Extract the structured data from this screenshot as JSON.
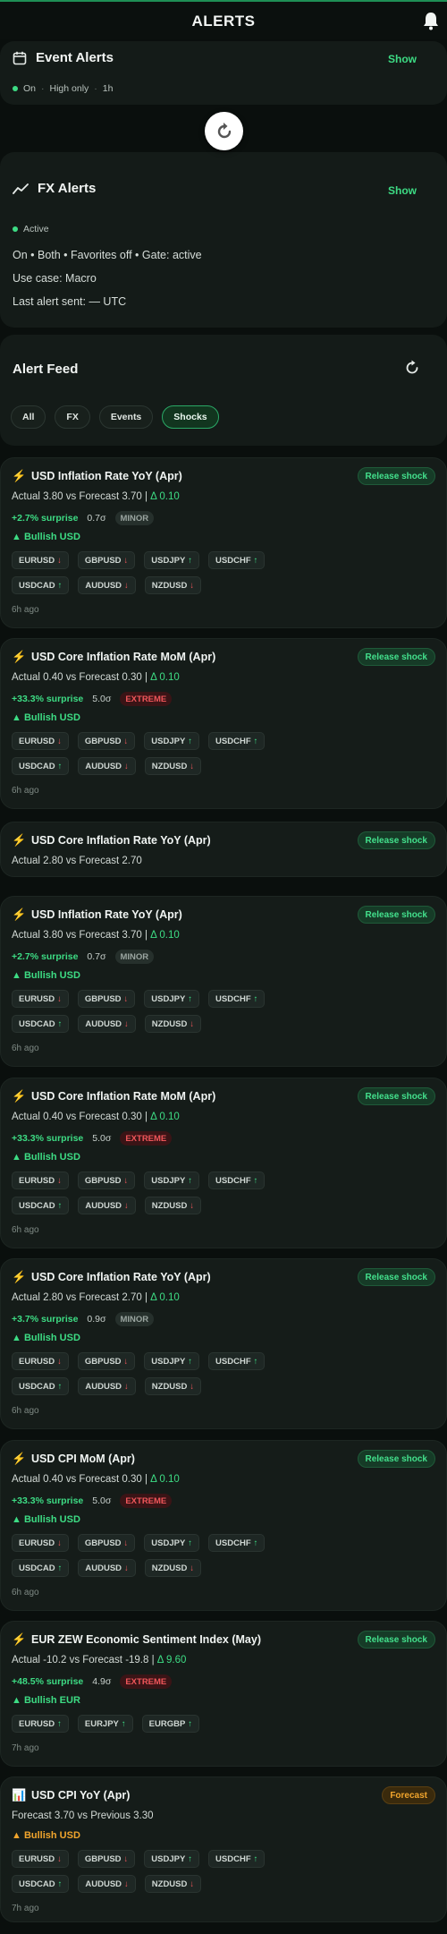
{
  "header": {
    "title": "ALERTS",
    "icon": "bell-icon"
  },
  "event_alerts": {
    "title": "Event Alerts",
    "icon": "calendar-icon",
    "show_label": "Show",
    "status": "On",
    "filter": "High only",
    "window": "1h"
  },
  "fx_alerts": {
    "title": "FX Alerts",
    "icon": "trend-line-icon",
    "show_label": "Show",
    "status": "Active",
    "line1": "On • Both • Favorites off • Gate: active",
    "line2": "Use case: Macro",
    "line3": "Last alert sent: — UTC"
  },
  "feed": {
    "title": "Alert Feed",
    "filters": [
      "All",
      "FX",
      "Events",
      "Shocks"
    ],
    "active_filter": "Shocks"
  },
  "cards": [
    {
      "icon": "⚡",
      "title": "USD Inflation Rate YoY (Apr)",
      "badge": "Release shock",
      "line1": "Actual 3.80 vs Forecast 3.70 | ",
      "delta": "Δ 0.10",
      "surprise": "+2.7% surprise",
      "sigma": "0.7σ",
      "tag": "MINOR",
      "bias": "▲ Bullish USD",
      "pairs": [
        {
          "name": "EURUSD",
          "dir": "↓"
        },
        {
          "name": "GBPUSD",
          "dir": "↓"
        },
        {
          "name": "USDJPY",
          "dir": "↑"
        },
        {
          "name": "USDCHF",
          "dir": "↑"
        },
        {
          "name": "USDCAD",
          "dir": "↑"
        },
        {
          "name": "AUDUSD",
          "dir": "↓"
        },
        {
          "name": "NZDUSD",
          "dir": "↓"
        }
      ],
      "ago": "6h ago"
    },
    {
      "icon": "⚡",
      "title": "USD Core Inflation Rate MoM (Apr)",
      "badge": "Release shock",
      "line1": "Actual 0.40 vs Forecast 0.30 | ",
      "delta": "Δ 0.10",
      "surprise": "+33.3% surprise",
      "sigma": "5.0σ",
      "tag": "EXTREME",
      "bias": "▲ Bullish USD",
      "pairs": [
        {
          "name": "EURUSD",
          "dir": "↓"
        },
        {
          "name": "GBPUSD",
          "dir": "↓"
        },
        {
          "name": "USDJPY",
          "dir": "↑"
        },
        {
          "name": "USDCHF",
          "dir": "↑"
        },
        {
          "name": "USDCAD",
          "dir": "↑"
        },
        {
          "name": "AUDUSD",
          "dir": "↓"
        },
        {
          "name": "NZDUSD",
          "dir": "↓"
        }
      ],
      "ago": "6h ago"
    },
    {
      "icon": "⚡",
      "title": "USD Core Inflation Rate YoY (Apr)",
      "badge": "Release shock",
      "line1": "Actual 2.80 vs Forecast 2.70"
    },
    {
      "icon": "⚡",
      "title": "USD Inflation Rate YoY (Apr)",
      "badge": "Release shock",
      "line1": "Actual 3.80 vs Forecast 3.70 | ",
      "delta": "Δ 0.10",
      "surprise": "+2.7% surprise",
      "sigma": "0.7σ",
      "tag": "MINOR",
      "bias": "▲ Bullish USD",
      "pairs": [
        {
          "name": "EURUSD",
          "dir": "↓"
        },
        {
          "name": "GBPUSD",
          "dir": "↓"
        },
        {
          "name": "USDJPY",
          "dir": "↑"
        },
        {
          "name": "USDCHF",
          "dir": "↑"
        },
        {
          "name": "USDCAD",
          "dir": "↑"
        },
        {
          "name": "AUDUSD",
          "dir": "↓"
        },
        {
          "name": "NZDUSD",
          "dir": "↓"
        }
      ],
      "ago": "6h ago"
    },
    {
      "icon": "⚡",
      "title": "USD Core Inflation Rate MoM (Apr)",
      "badge": "Release shock",
      "line1": "Actual 0.40 vs Forecast 0.30 | ",
      "delta": "Δ 0.10",
      "surprise": "+33.3% surprise",
      "sigma": "5.0σ",
      "tag": "EXTREME",
      "bias": "▲ Bullish USD",
      "pairs": [
        {
          "name": "EURUSD",
          "dir": "↓"
        },
        {
          "name": "GBPUSD",
          "dir": "↓"
        },
        {
          "name": "USDJPY",
          "dir": "↑"
        },
        {
          "name": "USDCHF",
          "dir": "↑"
        },
        {
          "name": "USDCAD",
          "dir": "↑"
        },
        {
          "name": "AUDUSD",
          "dir": "↓"
        },
        {
          "name": "NZDUSD",
          "dir": "↓"
        }
      ],
      "ago": "6h ago"
    },
    {
      "icon": "⚡",
      "title": "USD Core Inflation Rate YoY (Apr)",
      "badge": "Release shock",
      "line1": "Actual 2.80 vs Forecast 2.70 | ",
      "delta": "Δ 0.10",
      "surprise": "+3.7% surprise",
      "sigma": "0.9σ",
      "tag": "MINOR",
      "bias": "▲ Bullish USD",
      "pairs": [
        {
          "name": "EURUSD",
          "dir": "↓"
        },
        {
          "name": "GBPUSD",
          "dir": "↓"
        },
        {
          "name": "USDJPY",
          "dir": "↑"
        },
        {
          "name": "USDCHF",
          "dir": "↑"
        },
        {
          "name": "USDCAD",
          "dir": "↑"
        },
        {
          "name": "AUDUSD",
          "dir": "↓"
        },
        {
          "name": "NZDUSD",
          "dir": "↓"
        }
      ],
      "ago": "6h ago"
    },
    {
      "icon": "⚡",
      "title": "USD CPI MoM (Apr)",
      "badge": "Release shock",
      "line1": "Actual 0.40 vs Forecast 0.30 | ",
      "delta": "Δ 0.10",
      "surprise": "+33.3% surprise",
      "sigma": "5.0σ",
      "tag": "EXTREME",
      "bias": "▲ Bullish USD",
      "pairs": [
        {
          "name": "EURUSD",
          "dir": "↓"
        },
        {
          "name": "GBPUSD",
          "dir": "↓"
        },
        {
          "name": "USDJPY",
          "dir": "↑"
        },
        {
          "name": "USDCHF",
          "dir": "↑"
        },
        {
          "name": "USDCAD",
          "dir": "↑"
        },
        {
          "name": "AUDUSD",
          "dir": "↓"
        },
        {
          "name": "NZDUSD",
          "dir": "↓"
        }
      ],
      "ago": "6h ago"
    },
    {
      "icon": "⚡",
      "title": "EUR ZEW Economic Sentiment Index (May)",
      "badge": "Release shock",
      "line1": "Actual -10.2 vs Forecast -19.8 | ",
      "delta": "Δ 9.60",
      "surprise": "+48.5% surprise",
      "sigma": "4.9σ",
      "tag": "EXTREME",
      "bias": "▲ Bullish EUR",
      "pairs": [
        {
          "name": "EURUSD",
          "dir": "↑"
        },
        {
          "name": "EURJPY",
          "dir": "↑"
        },
        {
          "name": "EURGBP",
          "dir": "↑"
        }
      ],
      "ago": "7h ago"
    },
    {
      "icon": "📊",
      "title": "USD CPI YoY (Apr)",
      "badge": "Forecast",
      "badge_style": "forecast",
      "line1": "Forecast 3.70 vs Previous 3.30",
      "bias": "▲ Bullish USD",
      "bias_style": "amber",
      "pairs": [
        {
          "name": "EURUSD",
          "dir": "↓"
        },
        {
          "name": "GBPUSD",
          "dir": "↓"
        },
        {
          "name": "USDJPY",
          "dir": "↑"
        },
        {
          "name": "USDCHF",
          "dir": "↑"
        },
        {
          "name": "USDCAD",
          "dir": "↑"
        },
        {
          "name": "AUDUSD",
          "dir": "↓"
        },
        {
          "name": "NZDUSD",
          "dir": "↓"
        }
      ],
      "ago": "7h ago"
    }
  ],
  "colors": {
    "accent": "#3ddc84",
    "extreme": "#f0565a",
    "forecast": "#f1a52d",
    "background": "#0a0f0d"
  }
}
